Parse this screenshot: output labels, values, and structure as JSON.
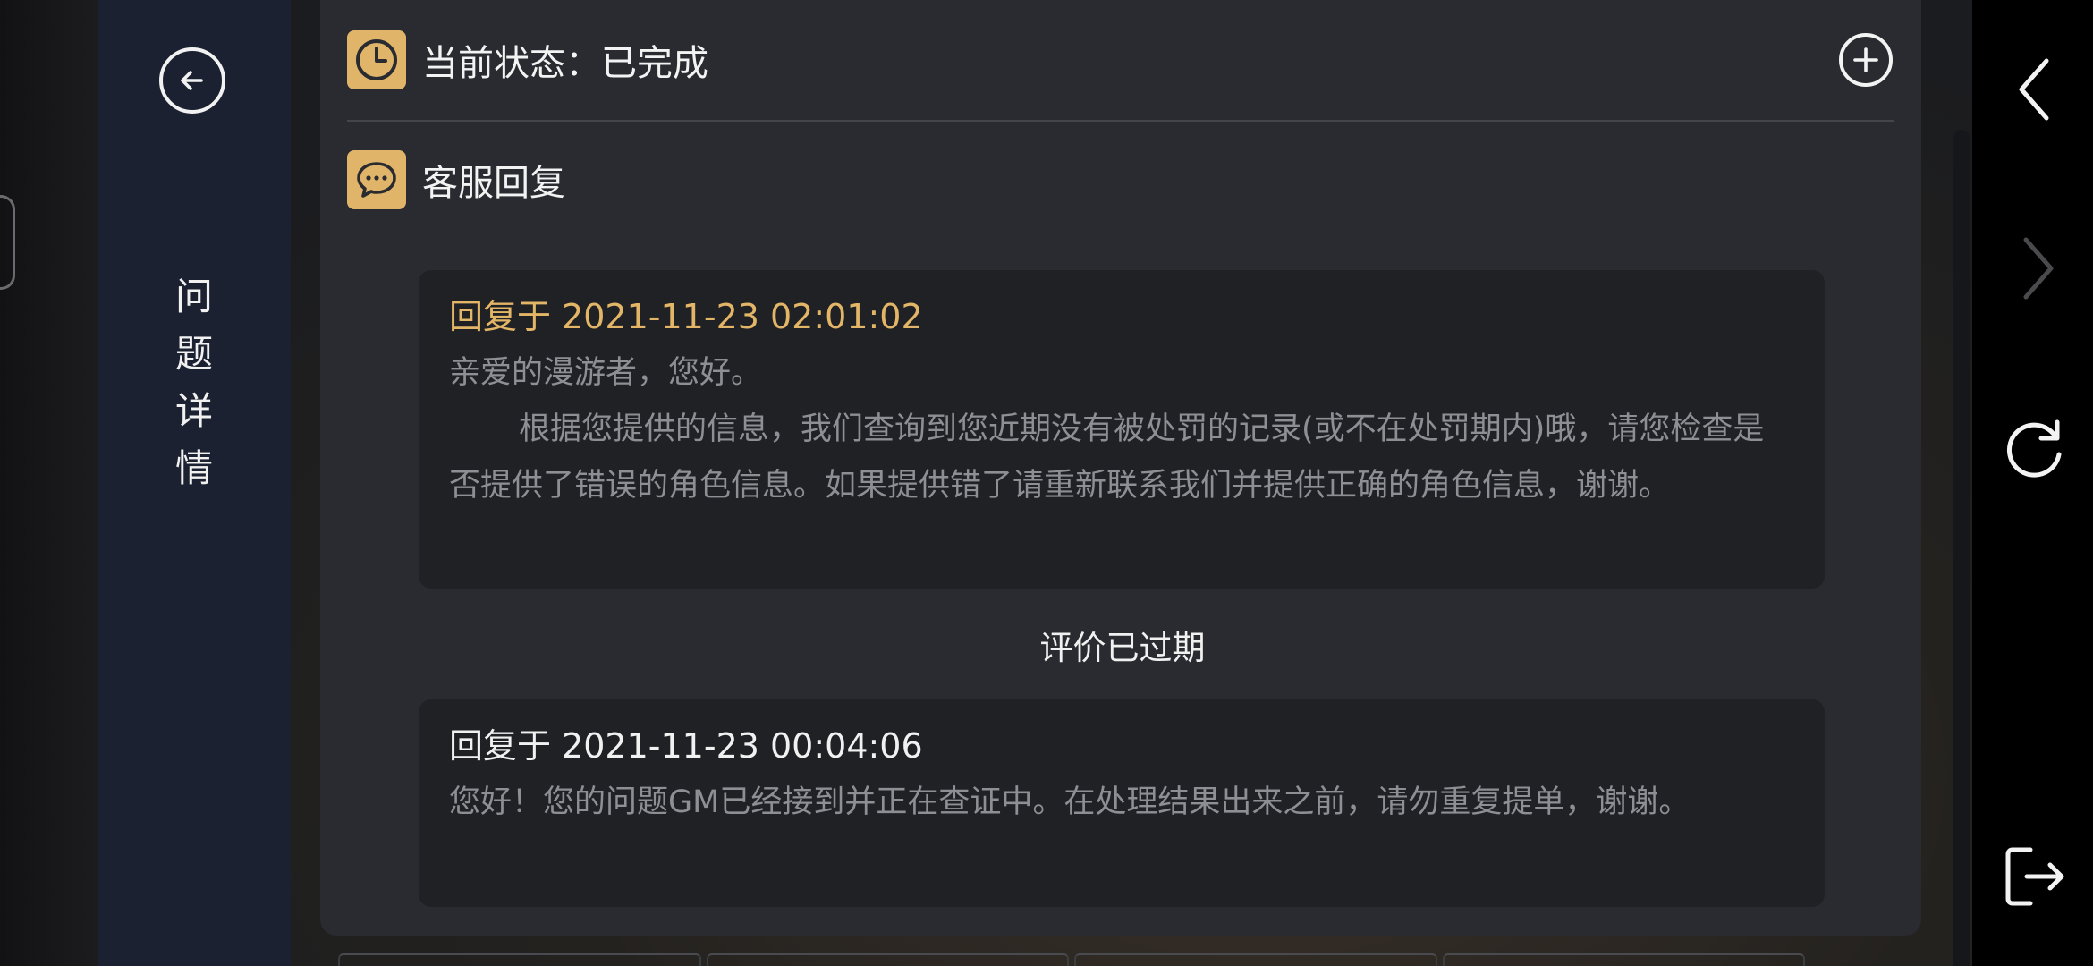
{
  "sidebar": {
    "title_chars": [
      "问",
      "题",
      "详",
      "情"
    ]
  },
  "status": {
    "label": "当前状态：已完成"
  },
  "reply_section": {
    "label": "客服回复"
  },
  "replies": [
    {
      "date": "回复于 2021-11-23 02:01:02",
      "greeting": "亲爱的漫游者，您好。",
      "body": "根据您提供的信息，我们查询到您近期没有被处罚的记录(或不在处罚期内)哦，请您检查是否提供了错误的角色信息。如果提供错了请重新联系我们并提供正确的角色信息，谢谢。"
    },
    {
      "date": "回复于 2021-11-23 00:04:06",
      "body": "您好！您的问题GM已经接到并正在查证中。在处理结果出来之前，请勿重复提单，谢谢。"
    }
  ],
  "rating": {
    "expired_label": "评价已过期"
  },
  "colors": {
    "accent_gold": "#e0b56a",
    "sidebar_bg": "#1b2130",
    "panel_bg": "#2a2b30",
    "card_bg": "#202125",
    "muted_text": "#8e8f94",
    "date_text_latest": "#e2b567",
    "date_text_older": "#f1f1f1"
  },
  "icons": {
    "back": "arrow-left-circle-icon",
    "status": "clock-icon",
    "reply": "chat-bubble-icon",
    "add": "plus-circle-icon",
    "nav_back": "chevron-left-icon",
    "nav_forward": "chevron-right-icon",
    "refresh": "refresh-icon",
    "exit": "exit-icon"
  }
}
